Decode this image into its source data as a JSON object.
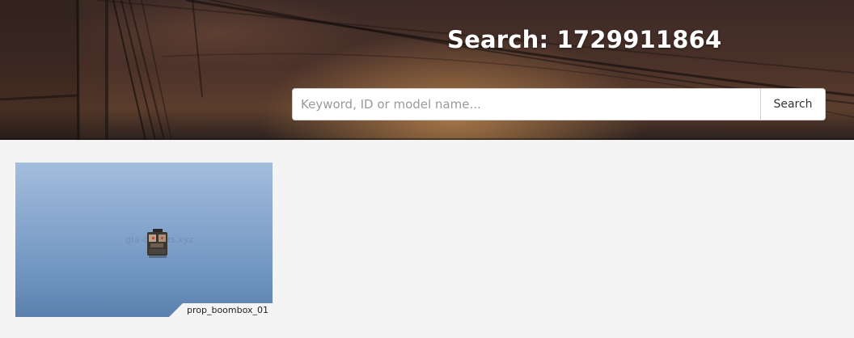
{
  "hero": {
    "title": "Search: 1729911864"
  },
  "search": {
    "placeholder": "Keyword, ID or model name...",
    "value": "",
    "button_label": "Search"
  },
  "results": [
    {
      "model_name": "prop_boombox_01",
      "watermark": "gta-objects.xyz"
    }
  ],
  "colors": {
    "page_background": "#f4f4f4",
    "thumbnail_sky_top": "#a4bedd",
    "thumbnail_sky_bottom": "#5b80ad"
  }
}
